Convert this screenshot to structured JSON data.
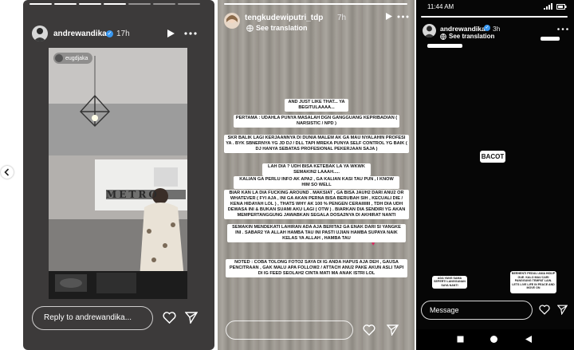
{
  "left_story": {
    "username": "andrewandika",
    "time": "17h",
    "tag": "eugdjaka",
    "wall_text": "Metro",
    "reply_placeholder": "Reply to andrewandika..."
  },
  "middle_story": {
    "username": "tengkudewiputri_tdp",
    "time": "7h",
    "see_translation": "See translation",
    "paragraphs": [
      "AND JUST LIKE THAT... YA BEGITULAAAA...",
      "PERTAMA : UDAHLA PUNYA MASALAH DGN GANGGUANG KEPRIBADIAN ( NARSISTIC / NPD )",
      "SKR BALIK LAGI KERJAANNYA DI DUNIA MALEM AK GA MAU NYALAHIN PROFESI YA . BYK SBNERNYA YG JD DJ / DLL TAPI MREKA PUNYA SELF CONTROL YG BAIK ( DJ HANYA SEBATAS PROFESIONAL PEKERJAAN SAJA )",
      "LAH DIA ? UDH BISA KETEBAK LA YA WKWK SEMAKIN2 LAAAH.....",
      "KALIAN GA PERLU INFO AK APA2 , GA KALIAN KASI TAU PUN , I KNOW HIM SO WELL",
      "BIAR KAN LA DIA FUCKING AROUND . MAKSIAT , GA BISA JAUH2 DARI ANU2 OR WHATEVER ( FYI AJA , INI GA AKAN PERNA BISA BERUBAH SIH , KECUALI DIE / KENA HIDAYAH LOL ) , THATS WHY AK 100 % PENGEN CERAIIIIIII , TDH DIA UDH DEWASA INI & BUKAN SUAMI AKU LAGI ( OTW ) . BIARKAN DIA SENDIRI YG AKAN MEMPERTANGGUNG JAWABKAN SEGALA DOSA2NYA DI AKHIRAT NANTI",
      "SEMAKIN MENDEKATI LAHIRAN ADA AJA BERITA2 GA ENAK DARI SI YANGKE INI . SABAR2 YA ALLAH HAMBA TAU INI PASTI UJIAN HAMBA SUPAYA NAIK KELAS YA ALLAH , HAMBA TAU",
      "NOTED : COBA TOLONG FOTO2 SAYA DI IG ANDA HAPUS AJA DEH , GAUSA PENCITRAAN , GAK MALU APA FOLLOW2 / ATTACH ANU2 PAKE AKUN ASLI TAPI DI IG FEED SEOLAH2 CINTA MATI MA ANAK ISTRI LOL"
    ]
  },
  "right_story": {
    "status_time": "11:44 AM",
    "username": "andrewandika",
    "time": "3h",
    "see_translation": "See translation",
    "sticker_main": "BACOT",
    "sticker_left": "ADA YANG SAMA SEPERTI LANGGANAN SAYA NANTI",
    "sticker_right": "BERHENTI PEDULI ANIA HIDUP GUE. KALO MAU CARI PANGGUNG TEMPAT LAIN. LETS LIVE LIFE IN PEACE AND MOVE ON",
    "message_placeholder": "Message"
  },
  "colors": {
    "verified": "#3897f0",
    "heart": "#e0245e"
  },
  "icons": [
    "chevron-left-icon",
    "play-icon",
    "more-icon",
    "heart-icon",
    "send-icon",
    "globe-icon",
    "back-nav-icon",
    "home-nav-icon",
    "recents-nav-icon"
  ]
}
